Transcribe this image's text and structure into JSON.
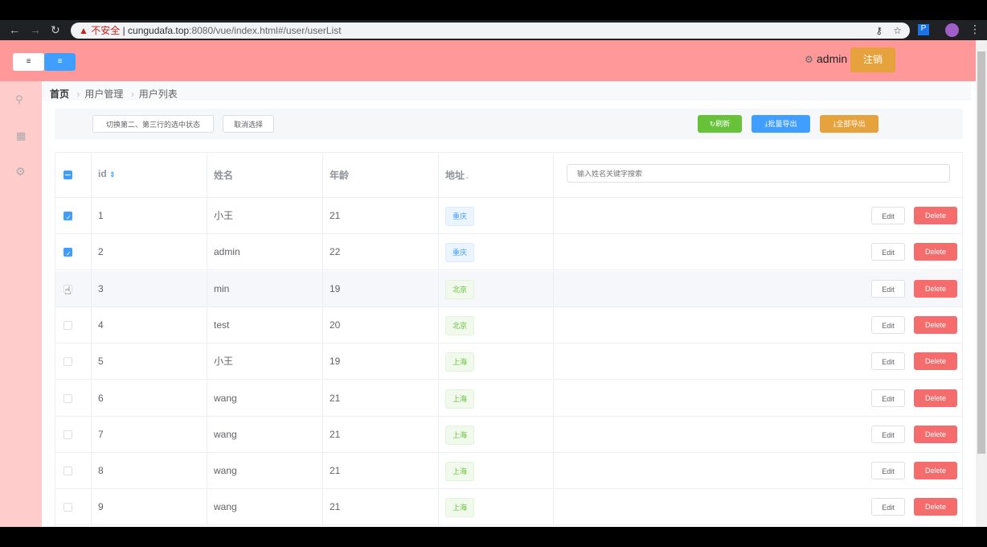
{
  "browser": {
    "insecure": "不安全",
    "url_host": "cungudafa.top",
    "url_rest": ":8080/vue/index.html#/user/userList"
  },
  "header": {
    "user": "admin",
    "logout": "注销"
  },
  "breadcrumb": [
    "首页",
    "用户管理",
    "用户列表"
  ],
  "toolbar": {
    "toggle": "切换第二、第三行的选中状态",
    "clear": "取消选择",
    "refresh": "刷新",
    "batch_export": "批量导出",
    "all_export": "全部导出"
  },
  "table": {
    "headers": {
      "id": "id",
      "name": "姓名",
      "age": "年龄",
      "address": "地址"
    },
    "search_placeholder": "输入姓名关键字搜索",
    "edit": "Edit",
    "delete": "Delete",
    "rows": [
      {
        "checked": true,
        "id": "1",
        "name": "小王",
        "age": "21",
        "address": "重庆",
        "tag": "blue"
      },
      {
        "checked": true,
        "id": "2",
        "name": "admin",
        "age": "22",
        "address": "重庆",
        "tag": "blue"
      },
      {
        "checked": false,
        "id": "3",
        "name": "min",
        "age": "19",
        "address": "北京",
        "tag": "green"
      },
      {
        "checked": false,
        "id": "4",
        "name": "test",
        "age": "20",
        "address": "北京",
        "tag": "green"
      },
      {
        "checked": false,
        "id": "5",
        "name": "小王",
        "age": "19",
        "address": "上海",
        "tag": "green"
      },
      {
        "checked": false,
        "id": "6",
        "name": "wang",
        "age": "21",
        "address": "上海",
        "tag": "green"
      },
      {
        "checked": false,
        "id": "7",
        "name": "wang",
        "age": "21",
        "address": "上海",
        "tag": "green"
      },
      {
        "checked": false,
        "id": "8",
        "name": "wang",
        "age": "21",
        "address": "上海",
        "tag": "green"
      },
      {
        "checked": false,
        "id": "9",
        "name": "wang",
        "age": "21",
        "address": "上海",
        "tag": "green"
      }
    ]
  },
  "colors": {
    "header": "#ff9999",
    "sidebar": "#ffcccc",
    "primary": "#409eff",
    "success": "#67c23a",
    "warning": "#e6a23c",
    "danger": "#f56c6c"
  }
}
